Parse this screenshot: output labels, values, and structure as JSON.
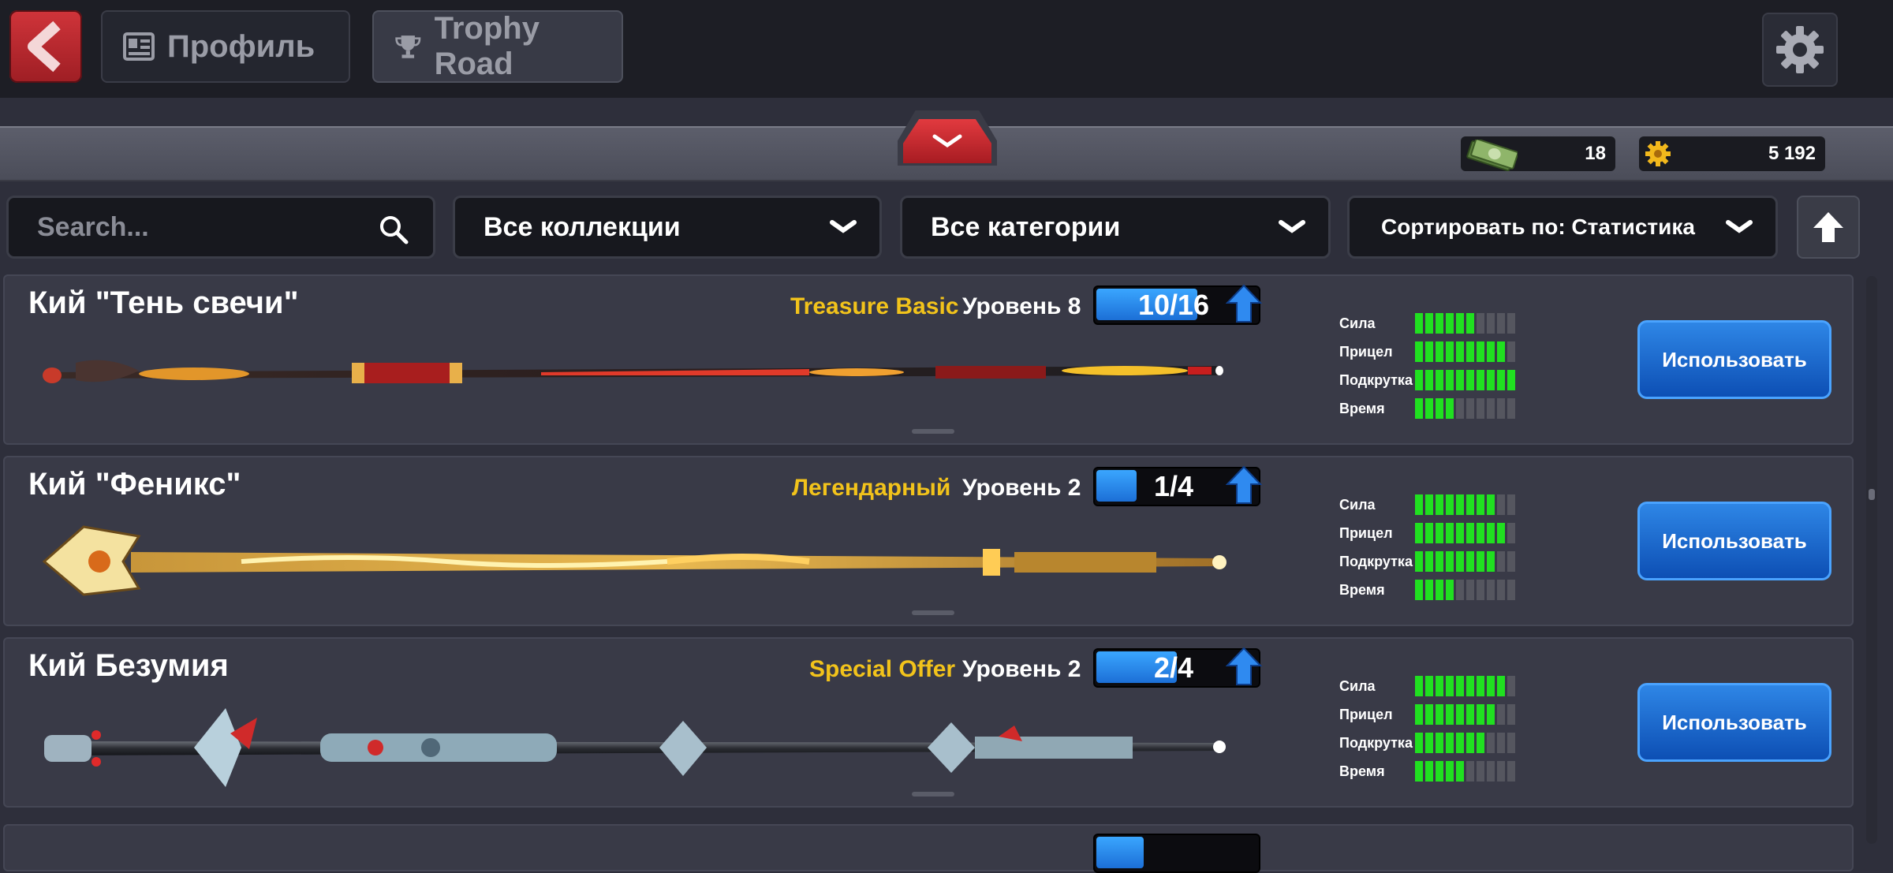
{
  "header": {
    "back_label": "back",
    "tabs": [
      {
        "label": "Профиль",
        "icon": "profile-card-icon"
      },
      {
        "label": "Trophy Road",
        "icon": "trophy-icon"
      }
    ],
    "settings_icon": "gear-icon"
  },
  "currency": {
    "cash": "18",
    "coins": "5 192"
  },
  "filters": {
    "search_placeholder": "Search...",
    "collection": "Все коллекции",
    "category": "Все категории",
    "sort": "Сортировать по: Статистика"
  },
  "colors": {
    "accent_blue": "#1c6fd6",
    "rarity_gold": "#f2c31b",
    "stat_green": "#20e020",
    "back_red": "#c12a30"
  },
  "stat_labels": [
    "Сила",
    "Прицел",
    "Подкрутка",
    "Время"
  ],
  "cues": [
    {
      "name": "Кий \"Тень свечи\"",
      "rarity": "Treasure Basic",
      "level": "Уровень 8",
      "progress": "10/16",
      "progress_fraction": 0.625,
      "stats": [
        6,
        9,
        10,
        4
      ],
      "button": "Использовать"
    },
    {
      "name": "Кий \"Феникс\"",
      "rarity": "Легендарный",
      "level": "Уровень 2",
      "progress": "1/4",
      "progress_fraction": 0.25,
      "stats": [
        8,
        9,
        8,
        4
      ],
      "button": "Использовать"
    },
    {
      "name": "Кий Безумия",
      "rarity": "Special Offer",
      "level": "Уровень 2",
      "progress": "2/4",
      "progress_fraction": 0.5,
      "stats": [
        9,
        8,
        7,
        5
      ],
      "button": "Использовать"
    }
  ]
}
